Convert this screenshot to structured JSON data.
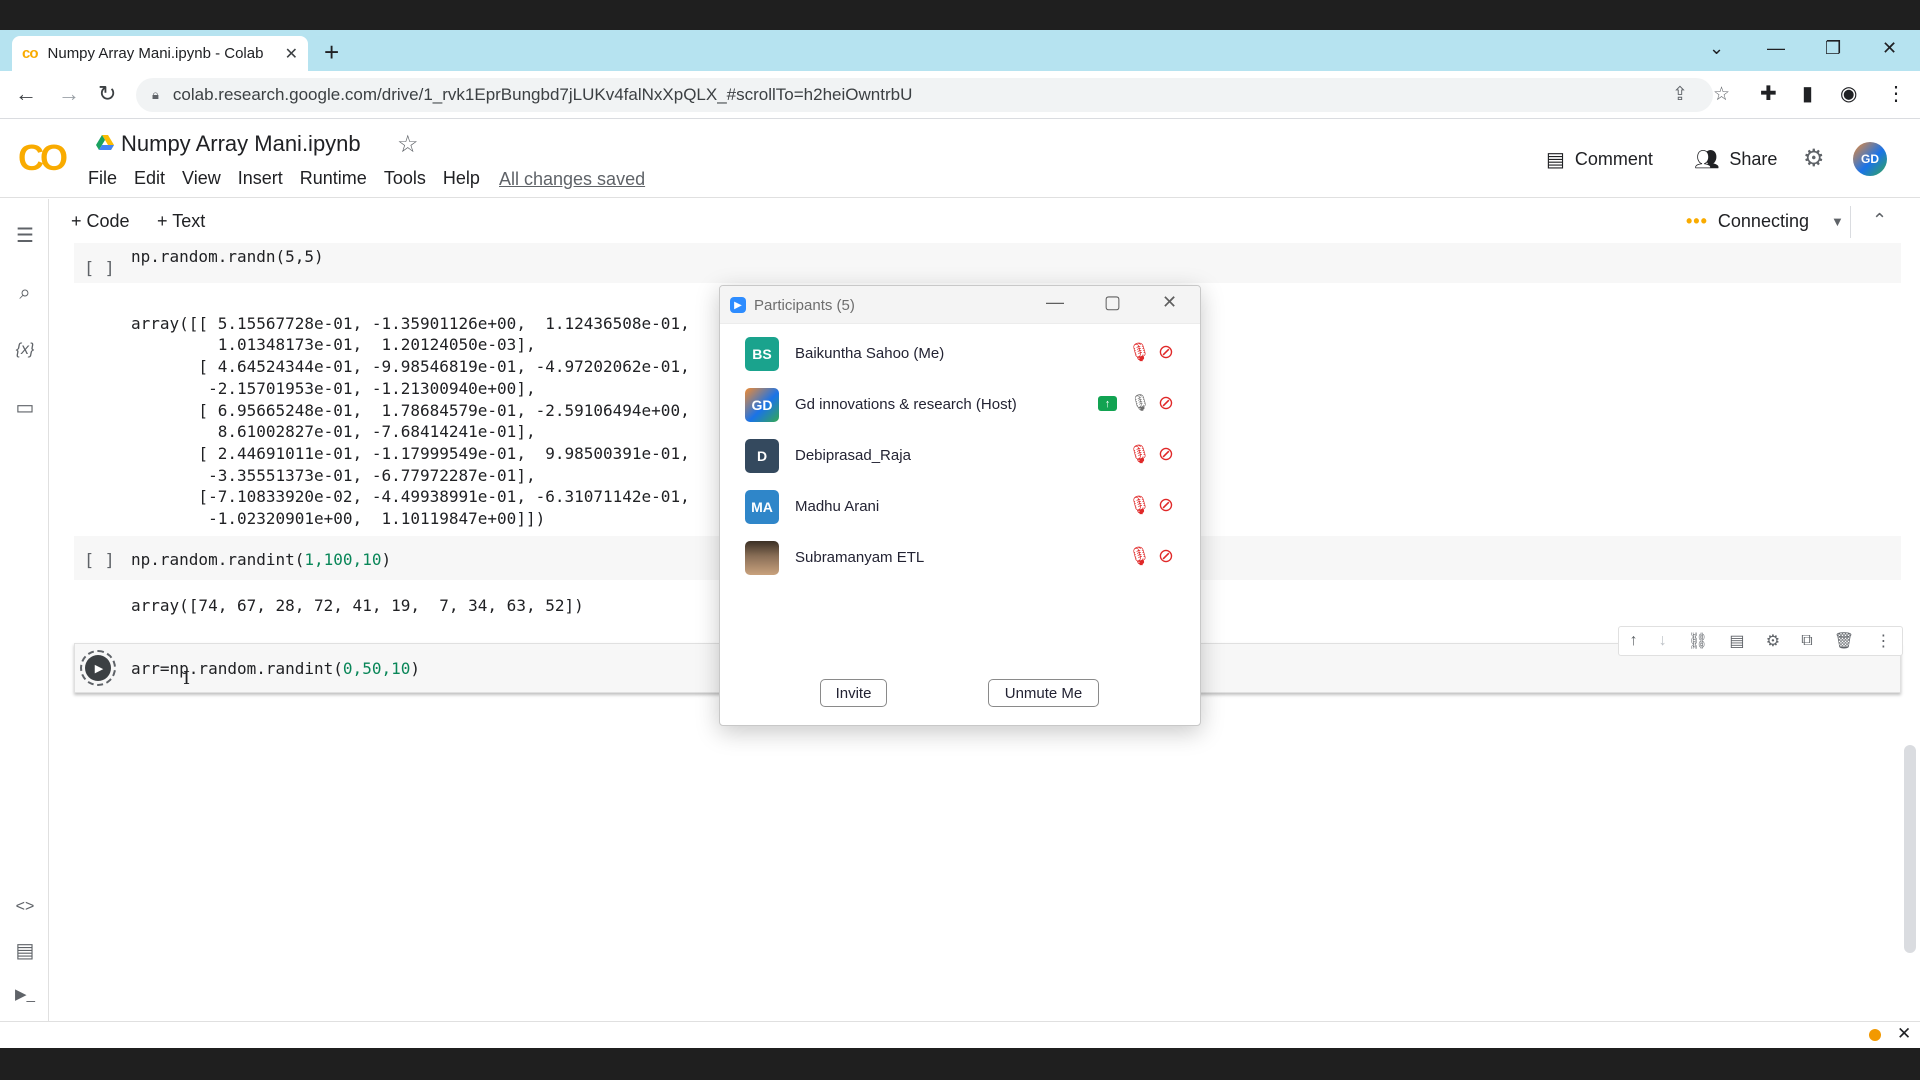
{
  "browser": {
    "tab_title": "Numpy Array Mani.ipynb - Colab",
    "tab_favicon": "co",
    "url": "colab.research.google.com/drive/1_rvk1EprBungbd7jLUKv4falNxXpQLX_#scrollTo=h2heiOwntrbU",
    "window_controls": {
      "minimize": "—",
      "restore": "❐",
      "close": "✕",
      "tab_search": "⌄"
    },
    "new_tab": "+"
  },
  "colab": {
    "logo": "CO",
    "title": "Numpy Array Mani.ipynb",
    "menu": [
      "File",
      "Edit",
      "View",
      "Insert",
      "Runtime",
      "Tools",
      "Help"
    ],
    "saved_status": "All changes saved",
    "comment_label": "Comment",
    "share_label": "Share",
    "avatar_text": "GD",
    "add_code": "+ Code",
    "add_text": "+ Text",
    "runtime_status": "Connecting",
    "runtime_dots": "•••"
  },
  "cells": {
    "cell1": {
      "bracket": "[ ]",
      "code": "np.random.randn(5,5)",
      "output": [
        "array([[ 5.15567728e-01, -1.35901126e+00,  1.12436508e-01,",
        "         1.01348173e-01,  1.20124050e-03],",
        "       [ 4.64524344e-01, -9.98546819e-01, -4.97202062e-01,",
        "        -2.15701953e-01, -1.21300940e+00],",
        "       [ 6.95665248e-01,  1.78684579e-01, -2.59106494e+00,",
        "         8.61002827e-01, -7.68414241e-01],",
        "       [ 2.44691011e-01, -1.17999549e-01,  9.98500391e-01,",
        "        -3.35551373e-01, -6.77972287e-01],",
        "       [-7.10833920e-02, -4.49938991e-01, -6.31071142e-01,",
        "        -1.02320901e+00,  1.10119847e+00]])"
      ]
    },
    "cell2": {
      "bracket": "[ ]",
      "code_prefix": "np.random.randint(",
      "code_args": "1,100,10",
      "code_suffix": ")",
      "output": "array([74, 67, 28, 72, 41, 19,  7, 34, 63, 52])"
    },
    "cell3": {
      "code_prefix": "arr=np.random.randint(",
      "code_args": "0,50,10",
      "code_suffix": ")"
    }
  },
  "participants": {
    "title": "Participants (5)",
    "list": [
      {
        "initials": "BS",
        "name": "Baikuntha Sahoo (Me)",
        "color": "#1aa38d"
      },
      {
        "initials": "GD",
        "name": "Gd innovations & research (Host)",
        "color": "#1a73e8"
      },
      {
        "initials": "D",
        "name": "Debiprasad_Raja",
        "color": "#34495e"
      },
      {
        "initials": "MA",
        "name": "Madhu Arani",
        "color": "#2f86c9"
      },
      {
        "initials": "",
        "name": "Subramanyam ETL",
        "color": "#6b5a4a"
      }
    ],
    "invite_label": "Invite",
    "unmute_label": "Unmute Me"
  }
}
